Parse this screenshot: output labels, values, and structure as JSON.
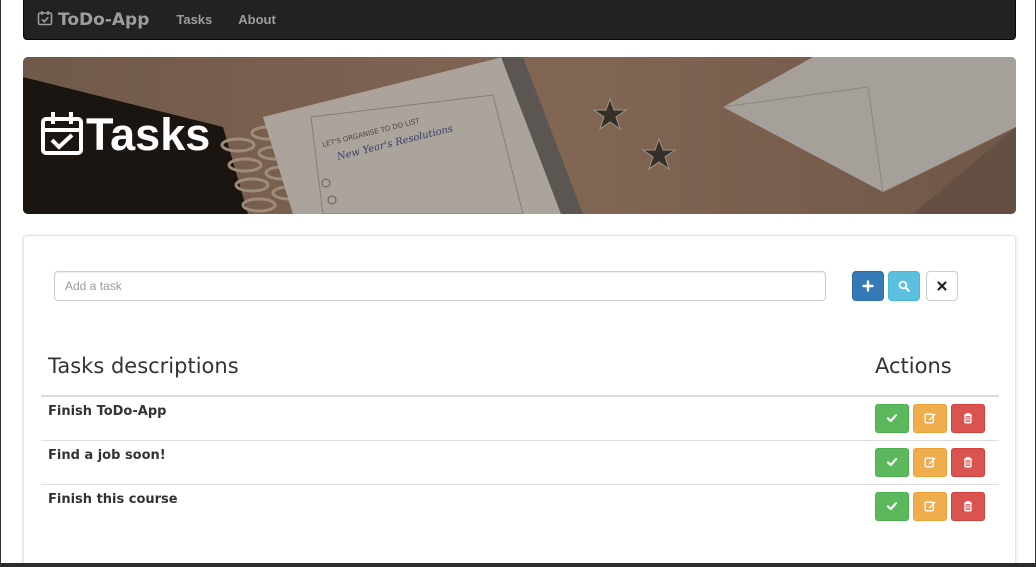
{
  "navbar": {
    "brand": "ToDo-App",
    "links": [
      "Tasks",
      "About"
    ]
  },
  "hero": {
    "title": "Tasks",
    "notebook_heading": "LET'S ORGANISE TO DO LIST",
    "notebook_handwriting": "New Year's Resolutions"
  },
  "search": {
    "placeholder": "Add a task"
  },
  "table": {
    "headers": {
      "description": "Tasks descriptions",
      "actions": "Actions"
    },
    "rows": [
      {
        "description": "Finish ToDo-App"
      },
      {
        "description": "Find a job soon!"
      },
      {
        "description": "Finish this course"
      }
    ]
  },
  "icons": {
    "brand": "calendar-check-icon",
    "add": "plus-icon",
    "search": "search-icon",
    "clear": "close-icon",
    "done": "check-icon",
    "edit": "edit-icon",
    "delete": "trash-icon"
  },
  "colors": {
    "primary": "#337ab7",
    "info": "#5bc0de",
    "success": "#5cb85c",
    "warning": "#f0ad4e",
    "danger": "#d9534f",
    "navbar": "#222222"
  }
}
